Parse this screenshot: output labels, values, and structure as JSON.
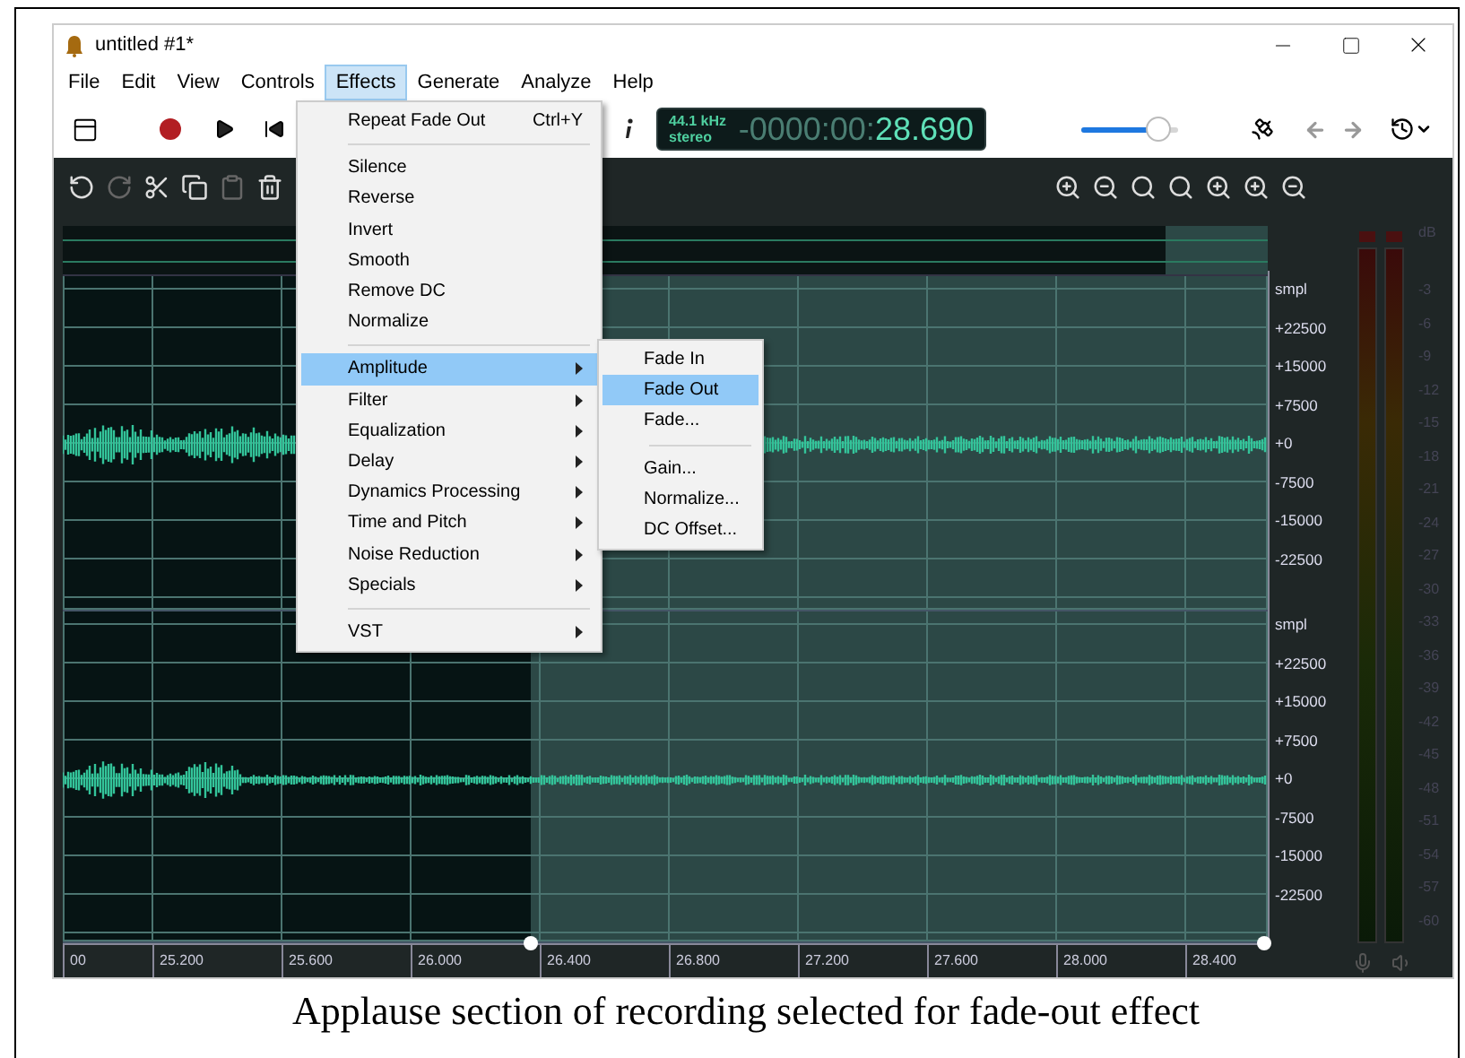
{
  "window": {
    "title": "untitled #1*"
  },
  "menu_bar": [
    {
      "label": "File",
      "selected": false
    },
    {
      "label": "Edit",
      "selected": false
    },
    {
      "label": "View",
      "selected": false
    },
    {
      "label": "Controls",
      "selected": false
    },
    {
      "label": "Effects",
      "selected": true
    },
    {
      "label": "Generate",
      "selected": false
    },
    {
      "label": "Analyze",
      "selected": false
    },
    {
      "label": "Help",
      "selected": false
    }
  ],
  "effects_menu": {
    "items": [
      {
        "kind": "command",
        "label": "Repeat Fade Out",
        "shortcut": "Ctrl+Y",
        "selected": false
      },
      {
        "kind": "separator"
      },
      {
        "kind": "command",
        "label": "Silence",
        "selected": false
      },
      {
        "kind": "command",
        "label": "Reverse",
        "selected": false
      },
      {
        "kind": "command",
        "label": "Invert",
        "selected": false
      },
      {
        "kind": "command",
        "label": "Smooth",
        "selected": false
      },
      {
        "kind": "command",
        "label": "Remove DC",
        "selected": false
      },
      {
        "kind": "command",
        "label": "Normalize",
        "selected": false
      },
      {
        "kind": "separator"
      },
      {
        "kind": "submenu",
        "label": "Amplitude",
        "selected": true
      },
      {
        "kind": "submenu",
        "label": "Filter",
        "selected": false
      },
      {
        "kind": "submenu",
        "label": "Equalization",
        "selected": false
      },
      {
        "kind": "submenu",
        "label": "Delay",
        "selected": false
      },
      {
        "kind": "submenu",
        "label": "Dynamics Processing",
        "selected": false
      },
      {
        "kind": "submenu",
        "label": "Time and Pitch",
        "selected": false
      },
      {
        "kind": "submenu",
        "label": "Noise Reduction",
        "selected": false
      },
      {
        "kind": "submenu",
        "label": "Specials",
        "selected": false
      },
      {
        "kind": "separator"
      },
      {
        "kind": "submenu",
        "label": "VST",
        "selected": false
      }
    ]
  },
  "amplitude_submenu": {
    "items": [
      {
        "kind": "command",
        "label": "Fade In",
        "selected": false
      },
      {
        "kind": "command",
        "label": "Fade Out",
        "selected": true
      },
      {
        "kind": "command",
        "label": "Fade...",
        "selected": false
      },
      {
        "kind": "separator"
      },
      {
        "kind": "command",
        "label": "Gain...",
        "selected": false
      },
      {
        "kind": "command",
        "label": "Normalize...",
        "selected": false
      },
      {
        "kind": "command",
        "label": "DC Offset...",
        "selected": false
      }
    ]
  },
  "display": {
    "sample_rate": "44.1 kHz",
    "channels": "stereo",
    "time_dim": "-0000:00:",
    "time": "28.690"
  },
  "volume": {
    "level": 0.8
  },
  "channel_axes": [
    {
      "unit": "smpl",
      "ticks": [
        "+22500",
        "+15000",
        "+7500",
        "+0",
        "-7500",
        "-15000",
        "-22500"
      ]
    },
    {
      "unit": "smpl",
      "ticks": [
        "+22500",
        "+15000",
        "+7500",
        "+0",
        "-7500",
        "-15000",
        "-22500"
      ]
    }
  ],
  "meter_scale": {
    "unit": "dB",
    "ticks": [
      "-3",
      "-6",
      "-9",
      "-12",
      "-15",
      "-18",
      "-21",
      "-24",
      "-27",
      "-30",
      "-33",
      "-36",
      "-39",
      "-42",
      "-45",
      "-48",
      "-51",
      "-54",
      "-57",
      "-60"
    ]
  },
  "time_ruler": [
    "00",
    "25.200",
    "25.600",
    "26.000",
    "26.400",
    "26.800",
    "27.200",
    "27.600",
    "28.000",
    "28.400"
  ],
  "caption": "Applause section of recording selected for fade-out effect"
}
